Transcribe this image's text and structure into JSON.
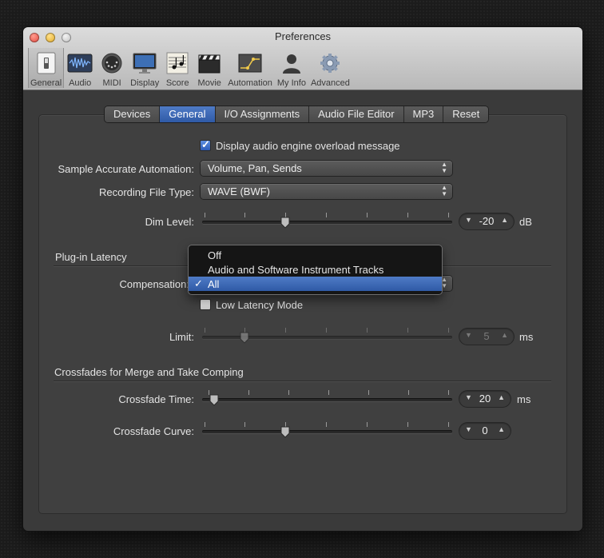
{
  "window": {
    "title": "Preferences"
  },
  "toolbar": [
    {
      "label": "General",
      "icon": "switch-icon"
    },
    {
      "label": "Audio",
      "icon": "waveform-icon"
    },
    {
      "label": "MIDI",
      "icon": "midi-port-icon"
    },
    {
      "label": "Display",
      "icon": "monitor-icon"
    },
    {
      "label": "Score",
      "icon": "music-notes-icon"
    },
    {
      "label": "Movie",
      "icon": "clapperboard-icon"
    },
    {
      "label": "Automation",
      "icon": "automation-curve-icon"
    },
    {
      "label": "My Info",
      "icon": "person-icon"
    },
    {
      "label": "Advanced",
      "icon": "gear-icon"
    }
  ],
  "tabs": [
    "Devices",
    "General",
    "I/O Assignments",
    "Audio File Editor",
    "MP3",
    "Reset"
  ],
  "active_tab": "General",
  "general": {
    "overload_checkbox": {
      "label": "Display audio engine overload message",
      "checked": true
    },
    "sample_accurate": {
      "label": "Sample Accurate Automation:",
      "value": "Volume, Pan, Sends"
    },
    "recording_file_type": {
      "label": "Recording File Type:",
      "value": "WAVE (BWF)"
    },
    "dim_level": {
      "label": "Dim Level:",
      "value": "-20",
      "unit": "dB"
    }
  },
  "plugin_latency": {
    "title": "Plug-in Latency",
    "compensation_label": "Compensation:",
    "compensation_options": [
      "Off",
      "Audio and Software Instrument Tracks",
      "All"
    ],
    "compensation_selected": "All",
    "low_latency": {
      "label": "Low Latency Mode",
      "checked": false
    },
    "limit": {
      "label": "Limit:",
      "value": "5",
      "unit": "ms"
    }
  },
  "crossfades": {
    "title": "Crossfades for Merge and Take Comping",
    "time": {
      "label": "Crossfade Time:",
      "value": "20",
      "unit": "ms"
    },
    "curve": {
      "label": "Crossfade Curve:",
      "value": "0"
    }
  },
  "colors": {
    "accent": "#3b68b8",
    "panel": "#404040",
    "window": "#3a3a3a"
  }
}
